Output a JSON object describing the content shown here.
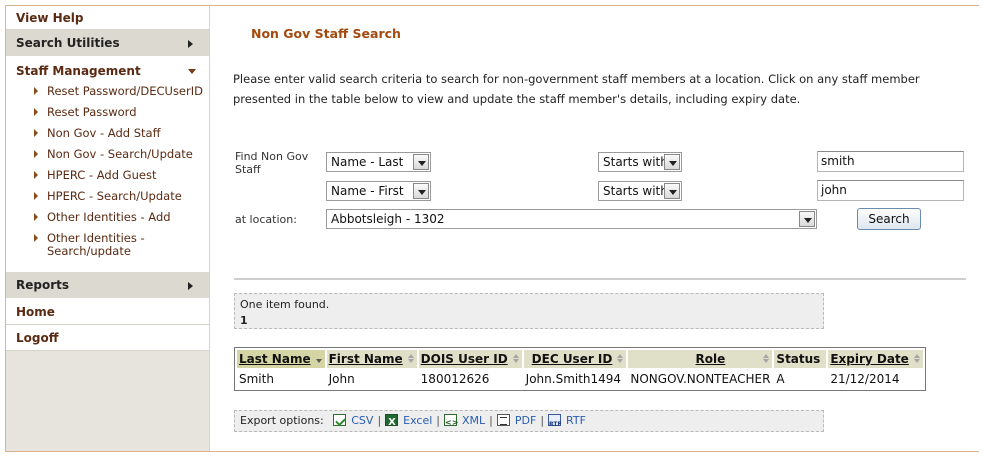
{
  "sidebar": {
    "view_help": "View Help",
    "search_utilities": "Search Utilities",
    "staff_management": "Staff Management",
    "staff_items": [
      "Reset Password/DECUserID",
      "Reset Password",
      "Non Gov - Add Staff",
      "Non Gov - Search/Update",
      "HPERC - Add Guest",
      "HPERC - Search/Update",
      "Other Identities - Add",
      "Other Identities - Search/update"
    ],
    "reports": "Reports",
    "home": "Home",
    "logoff": "Logoff"
  },
  "main": {
    "title": "Non Gov Staff Search",
    "intro": "Please enter valid search criteria to search for non-government staff members at a location. Click on any staff member presented in the table below to view and update the staff member's details, including expiry date."
  },
  "form": {
    "find_label": "Find Non Gov Staff",
    "field1": "Name - Last",
    "op1": "Starts with",
    "value1": "smith",
    "field2": "Name - First",
    "op2": "Starts with",
    "value2": "john",
    "location_label": "at location:",
    "location": "Abbotsleigh - 1302",
    "search_label": "Search"
  },
  "results": {
    "summary": "One item found.",
    "page": "1",
    "columns": [
      "Last Name",
      "First Name",
      "DOIS User ID",
      "DEC User ID",
      "Role",
      "Status",
      "Expiry Date"
    ],
    "rows": [
      [
        "Smith",
        "John",
        "180012626",
        "John.Smith1494",
        "NONGOV.NONTEACHER",
        "A",
        "21/12/2014"
      ]
    ]
  },
  "export": {
    "label": "Export options:",
    "csv": "CSV",
    "excel": "Excel",
    "xml": "XML",
    "pdf": "PDF",
    "rtf": "RTF"
  },
  "colors": {
    "title": "#a34a0f",
    "nav_text": "#5a2a12",
    "sidebar_bg": "#e6e4dc",
    "header_bg": "#e0e0c8",
    "frame_border": "#d9b48f",
    "link": "#2a5db0"
  }
}
